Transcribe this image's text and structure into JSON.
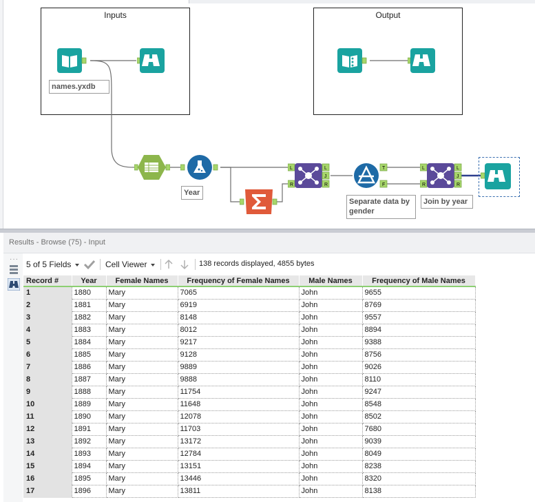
{
  "canvas": {
    "containers": [
      {
        "title": "Inputs"
      },
      {
        "title": "Output"
      }
    ],
    "tools": {
      "input_data": {
        "icon": "book-input-icon",
        "annotation": "names.yxdb"
      },
      "browse_inputs": {
        "icon": "binoculars-icon"
      },
      "output_data": {
        "icon": "book-output-icon"
      },
      "browse_output": {
        "icon": "binoculars-icon"
      },
      "crosstab": {
        "icon": "crosstab-icon"
      },
      "formula": {
        "icon": "flask-icon",
        "annotation": "Year"
      },
      "summarize": {
        "icon": "sigma-icon"
      },
      "join_1": {
        "icon": "join-icon",
        "ports": [
          "L",
          "J",
          "R"
        ]
      },
      "filter": {
        "icon": "filter-icon",
        "annotation": "Separate data by gender",
        "ports": [
          "T",
          "F"
        ]
      },
      "join_2": {
        "icon": "join-icon",
        "annotation": "Join by year",
        "ports": [
          "L",
          "J",
          "R"
        ]
      },
      "browse_final": {
        "icon": "binoculars-icon"
      }
    }
  },
  "results": {
    "title": "Results - Browse (75) - Input",
    "toolbar": {
      "fields": "5 of 5 Fields",
      "viewer": "Cell Viewer",
      "status": "138 records displayed, 4855 bytes"
    },
    "columns": [
      "Record #",
      "Year",
      "Female Names",
      "Frequency of Female Names",
      "Male Names",
      "Frequency of Male Names"
    ],
    "rows": [
      [
        "1",
        "1880",
        "Mary",
        "7065",
        "John",
        "9655"
      ],
      [
        "2",
        "1881",
        "Mary",
        "6919",
        "John",
        "8769"
      ],
      [
        "3",
        "1882",
        "Mary",
        "8148",
        "John",
        "9557"
      ],
      [
        "4",
        "1883",
        "Mary",
        "8012",
        "John",
        "8894"
      ],
      [
        "5",
        "1884",
        "Mary",
        "9217",
        "John",
        "9388"
      ],
      [
        "6",
        "1885",
        "Mary",
        "9128",
        "John",
        "8756"
      ],
      [
        "7",
        "1886",
        "Mary",
        "9889",
        "John",
        "9026"
      ],
      [
        "8",
        "1887",
        "Mary",
        "9888",
        "John",
        "8110"
      ],
      [
        "9",
        "1888",
        "Mary",
        "11754",
        "John",
        "9247"
      ],
      [
        "10",
        "1889",
        "Mary",
        "11648",
        "John",
        "8548"
      ],
      [
        "11",
        "1890",
        "Mary",
        "12078",
        "John",
        "8502"
      ],
      [
        "12",
        "1891",
        "Mary",
        "11703",
        "John",
        "7680"
      ],
      [
        "13",
        "1892",
        "Mary",
        "13172",
        "John",
        "9039"
      ],
      [
        "14",
        "1893",
        "Mary",
        "12784",
        "John",
        "8049"
      ],
      [
        "15",
        "1894",
        "Mary",
        "13151",
        "John",
        "8238"
      ],
      [
        "16",
        "1895",
        "Mary",
        "13446",
        "John",
        "8320"
      ],
      [
        "17",
        "1896",
        "Mary",
        "13811",
        "John",
        "8138"
      ]
    ]
  },
  "colors": {
    "tool_teal": "#1aa3a0",
    "tool_green": "#8db64c",
    "tool_blue": "#1e6aa6",
    "tool_orange": "#e05a3a",
    "tool_purple": "#5b4a9a",
    "port_green": "#a7d66a",
    "grid_header_underline": "#8ccf72"
  }
}
